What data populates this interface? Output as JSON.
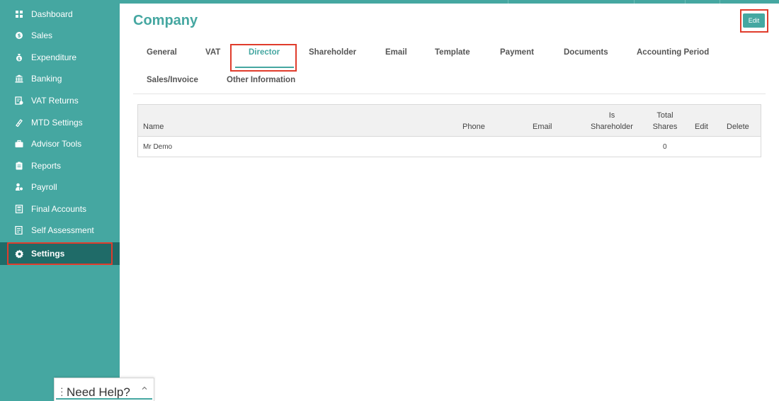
{
  "sidebar": {
    "items": [
      {
        "label": "Dashboard",
        "icon": "dashboard-icon"
      },
      {
        "label": "Sales",
        "icon": "sales-icon"
      },
      {
        "label": "Expenditure",
        "icon": "expenditure-icon"
      },
      {
        "label": "Banking",
        "icon": "bank-icon"
      },
      {
        "label": "VAT Returns",
        "icon": "vat-returns-icon"
      },
      {
        "label": "MTD Settings",
        "icon": "mtd-settings-icon"
      },
      {
        "label": "Advisor Tools",
        "icon": "briefcase-icon"
      },
      {
        "label": "Reports",
        "icon": "reports-icon"
      },
      {
        "label": "Payroll",
        "icon": "payroll-icon"
      },
      {
        "label": "Final Accounts",
        "icon": "final-accounts-icon"
      },
      {
        "label": "Self Assessment",
        "icon": "self-assessment-icon"
      },
      {
        "label": "Settings",
        "icon": "gear-icon",
        "active": true
      }
    ]
  },
  "page": {
    "title": "Company",
    "edit_label": "Edit"
  },
  "tabs": [
    {
      "label": "General"
    },
    {
      "label": "VAT"
    },
    {
      "label": "Director",
      "active": true
    },
    {
      "label": "Shareholder"
    },
    {
      "label": "Email"
    },
    {
      "label": "Template"
    },
    {
      "label": "Payment"
    },
    {
      "label": "Documents"
    },
    {
      "label": "Accounting Period"
    },
    {
      "label": "Sales/Invoice"
    },
    {
      "label": "Other Information"
    }
  ],
  "table": {
    "headers": {
      "name": "Name",
      "phone": "Phone",
      "email": "Email",
      "is_shareholder_1": "Is",
      "is_shareholder_2": "Shareholder",
      "total_shares_1": "Total",
      "total_shares_2": "Shares",
      "edit": "Edit",
      "delete": "Delete"
    },
    "rows": [
      {
        "name": "Mr Demo",
        "phone": "",
        "email": "",
        "is_shareholder": "",
        "total_shares": "0"
      }
    ]
  },
  "help": {
    "label": "Need Help?"
  },
  "colors": {
    "accent": "#45a7a1",
    "sidebar_active": "#1f6b68",
    "highlight": "#e03c2c"
  }
}
